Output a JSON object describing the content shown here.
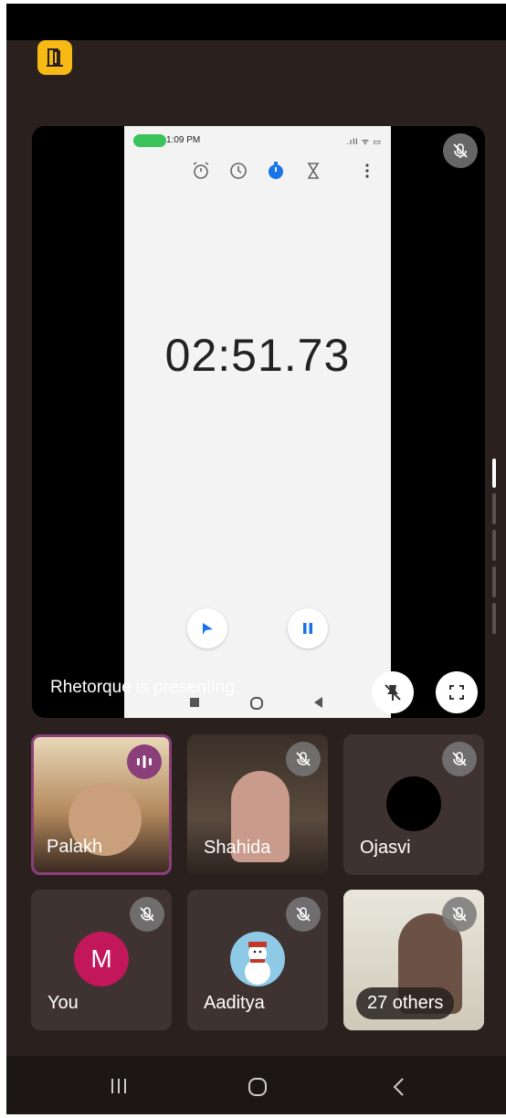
{
  "presentation": {
    "presenter_text": "Rhetorque is presenting",
    "shared_phone": {
      "time": "1:09 PM",
      "status_right": ".ıll ᯤ ▭",
      "timer": "02:51.73",
      "tabs": [
        "alarm-icon",
        "clock-icon",
        "stopwatch-icon",
        "timer-icon"
      ]
    }
  },
  "participants": [
    {
      "name": "Palakh",
      "speaking": true
    },
    {
      "name": "Shahida",
      "muted": true
    },
    {
      "name": "Ojasvi",
      "muted": true
    },
    {
      "name": "You",
      "avatar_letter": "M",
      "avatar_color": "#c2185b",
      "muted": true
    },
    {
      "name": "Aaditya",
      "muted": true
    },
    {
      "name": "27 others",
      "muted": true
    }
  ],
  "colors": {
    "background": "#2a211f",
    "tile": "#3e3331",
    "accent_app": "#f7b913",
    "speaking_ring": "#8a3f7a"
  }
}
